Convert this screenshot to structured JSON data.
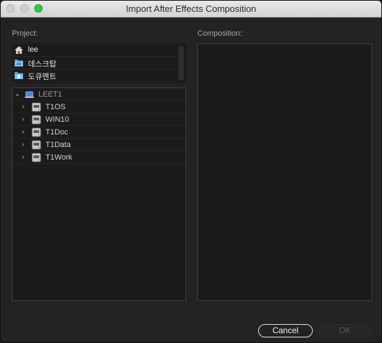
{
  "window": {
    "title": "Import After Effects Composition",
    "accent_zoom_color": "#2ec840"
  },
  "project": {
    "label": "Project:",
    "places": [
      {
        "icon": "home-icon",
        "label": "lee"
      },
      {
        "icon": "folder-icon",
        "label": "데스크탑"
      },
      {
        "icon": "documents-folder-icon",
        "label": "도큐멘트"
      }
    ],
    "tree": {
      "root": {
        "icon": "computer-icon",
        "label": "LEET1",
        "expanded": true
      },
      "drives": [
        {
          "icon": "drive-icon",
          "label": "T1OS"
        },
        {
          "icon": "drive-icon",
          "label": "WIN10"
        },
        {
          "icon": "drive-icon",
          "label": "T1Doc"
        },
        {
          "icon": "drive-icon",
          "label": "T1Data"
        },
        {
          "icon": "drive-icon",
          "label": "T1Work"
        }
      ]
    }
  },
  "composition": {
    "label": "Composition:"
  },
  "buttons": {
    "cancel": "Cancel",
    "ok": "OK"
  }
}
